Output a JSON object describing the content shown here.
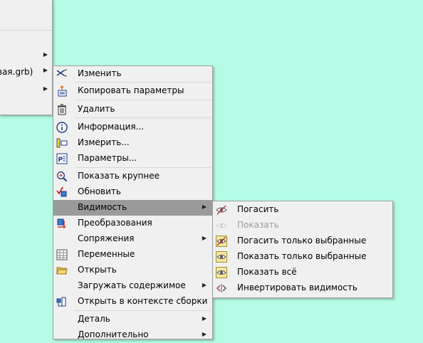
{
  "left_menu": {
    "items": [
      {
        "label": "",
        "arrow": false
      },
      {
        "label": "",
        "arrow": true
      },
      {
        "label": "вая.grb)",
        "arrow": true
      },
      {
        "label": "",
        "arrow": true
      }
    ]
  },
  "context_menu": {
    "items": [
      {
        "label": "Изменить",
        "icon": "scissors-icon"
      },
      {
        "label": "Копировать параметры",
        "icon": "copy-params-icon"
      },
      {
        "label": "Удалить",
        "icon": "trash-icon"
      },
      {
        "label": "Информация...",
        "icon": "info-icon"
      },
      {
        "label": "Измерить...",
        "icon": "measure-icon"
      },
      {
        "label": "Параметры...",
        "icon": "parameters-icon"
      },
      {
        "label": "Показать крупнее",
        "icon": "zoom-in-icon"
      },
      {
        "label": "Обновить",
        "icon": "refresh-icon"
      },
      {
        "label": "Видимость",
        "icon": "",
        "submenu": true,
        "highlighted": true
      },
      {
        "label": "Преобразования",
        "icon": "transform-icon"
      },
      {
        "label": "Сопряжения",
        "icon": "",
        "submenu": true
      },
      {
        "label": "Переменные",
        "icon": "variables-icon"
      },
      {
        "label": "Открыть",
        "icon": "open-folder-icon"
      },
      {
        "label": "Загружать содержимое",
        "icon": "",
        "submenu": true
      },
      {
        "label": "Открыть в контексте сборки",
        "icon": "open-in-assembly-icon"
      },
      {
        "label": "Деталь",
        "icon": "",
        "submenu": true
      },
      {
        "label": "Дополнительно",
        "icon": "",
        "submenu": true
      }
    ]
  },
  "visibility_submenu": {
    "items": [
      {
        "label": "Погасить",
        "icon": "hide-eye-icon",
        "enabled": true
      },
      {
        "label": "Показать",
        "icon": "show-eye-icon",
        "enabled": false
      },
      {
        "label": "Погасить только выбранные",
        "icon": "hide-selected-icon",
        "enabled": true
      },
      {
        "label": "Показать только выбранные",
        "icon": "show-selected-icon",
        "enabled": true
      },
      {
        "label": "Показать всё",
        "icon": "show-all-icon",
        "enabled": true
      },
      {
        "label": "Инвертировать видимость",
        "icon": "invert-visibility-icon",
        "enabled": true
      }
    ]
  },
  "colors": {
    "desktop_background": "#b5fce6",
    "menu_background": "#f0f0f0",
    "highlight": "#9a9a9a"
  }
}
